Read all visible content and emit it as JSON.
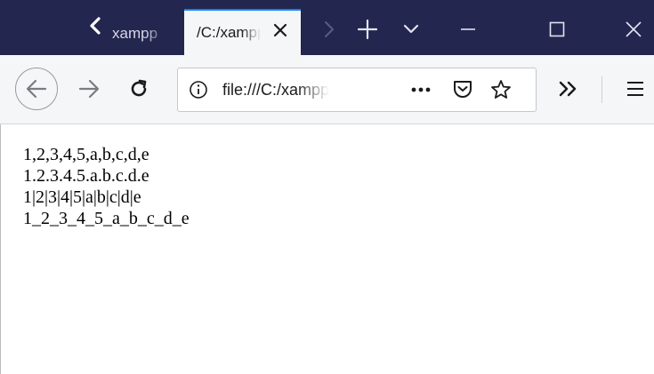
{
  "tabs": [
    {
      "title": "xampp",
      "active": false
    },
    {
      "title": "/C:/xampp",
      "active": true
    }
  ],
  "address_bar": {
    "url": "file:///C:/xampp"
  },
  "icons": {
    "scroll_left": "chevron-left-icon",
    "tab_close": "close-icon",
    "scroll_right": "chevron-right-icon",
    "new_tab": "plus-icon",
    "tab_list": "chevron-down-icon",
    "minimize": "minimize-icon",
    "maximize": "maximize-icon",
    "close_window": "close-icon",
    "back": "arrow-left-icon",
    "forward": "arrow-right-icon",
    "reload": "reload-icon",
    "site_info": "info-icon",
    "page_actions": "more-icon",
    "pocket": "pocket-icon",
    "bookmark": "star-icon",
    "overflow": "double-chevron-right-icon",
    "menu": "hamburger-menu-icon"
  },
  "colors": {
    "tabstrip": "#23264f",
    "active_tab": "#f5f6f7",
    "active_tab_accent": "#0a84ff",
    "toolbar": "#f5f6f7",
    "page_background": "#ffffff"
  },
  "page": {
    "lines": [
      "1,2,3,4,5,a,b,c,d,e",
      "1.2.3.4.5.a.b.c.d.e",
      "1|2|3|4|5|a|b|c|d|e",
      "1_2_3_4_5_a_b_c_d_e"
    ]
  }
}
